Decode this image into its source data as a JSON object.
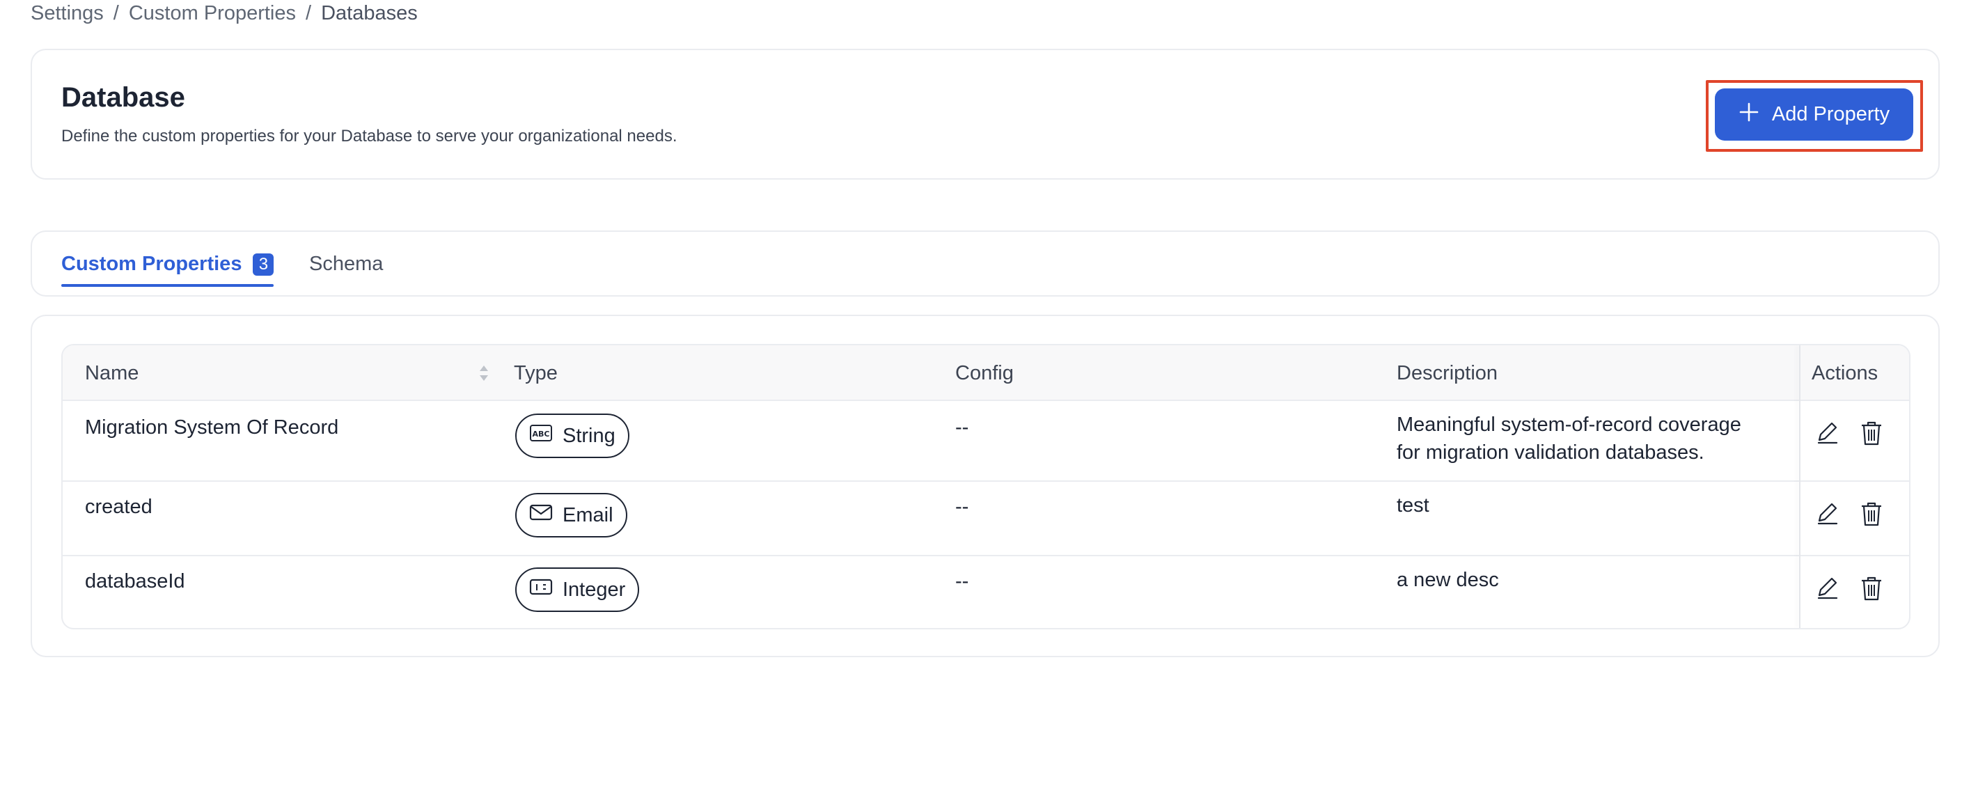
{
  "breadcrumb": {
    "items": [
      "Settings",
      "Custom Properties",
      "Databases"
    ],
    "separator": "/"
  },
  "header": {
    "title": "Database",
    "description": "Define the custom properties for your Database to serve your organizational needs.",
    "add_button_label": "Add Property"
  },
  "tabs": {
    "custom_properties_label": "Custom Properties",
    "custom_properties_count": "3",
    "schema_label": "Schema"
  },
  "table": {
    "columns": {
      "name": "Name",
      "type": "Type",
      "config": "Config",
      "description": "Description",
      "actions": "Actions"
    },
    "rows": [
      {
        "name": "Migration System Of Record",
        "type": "String",
        "type_icon": "abc-icon",
        "config": "--",
        "description_line1": "Meaningful system-of-record coverage",
        "description_line2": "for migration validation databases."
      },
      {
        "name": "created",
        "type": "Email",
        "type_icon": "envelope-icon",
        "config": "--",
        "description_line1": "test",
        "description_line2": ""
      },
      {
        "name": "databaseId",
        "type": "Integer",
        "type_icon": "number-icon",
        "config": "--",
        "description_line1": "a new desc",
        "description_line2": ""
      }
    ]
  },
  "colors": {
    "accent": "#2f5fd6",
    "highlight_border": "#e0452a",
    "border": "#eaecf0",
    "header_bg": "#f8f8f9"
  }
}
